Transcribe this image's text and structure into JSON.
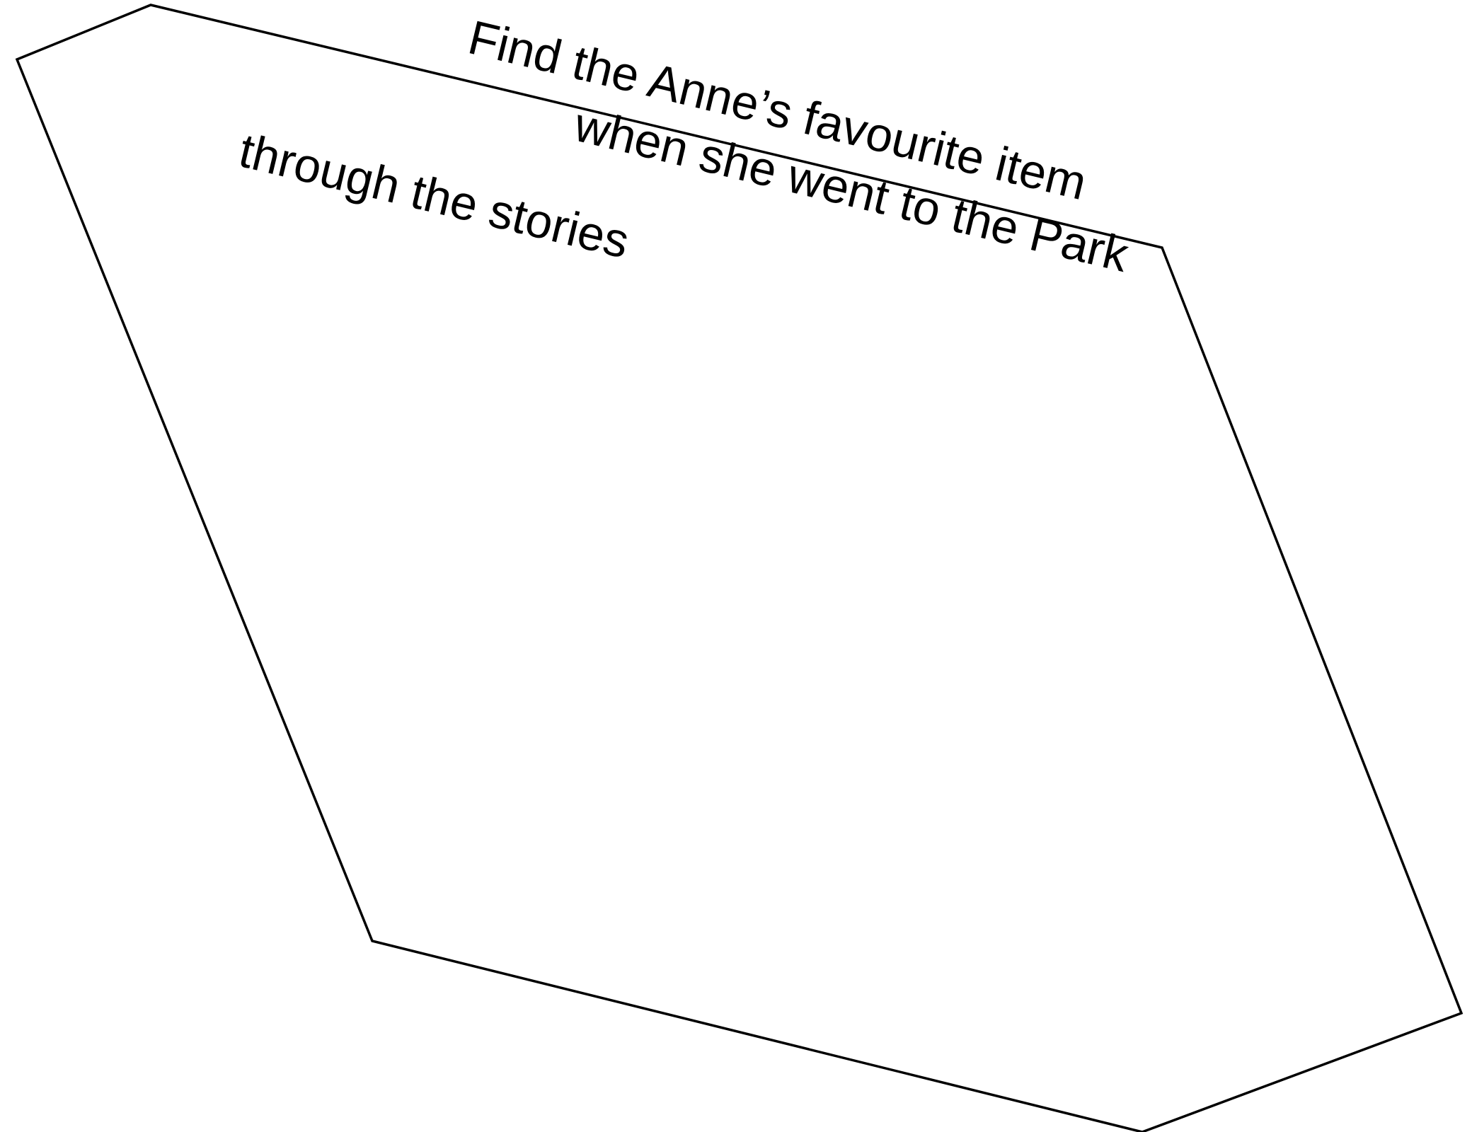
{
  "lines": {
    "line1": "Find the Anne’s favourite item",
    "line2": "when she went to the Park",
    "line3": "through the stories"
  },
  "colors": {
    "outline": "#000000",
    "text": "#000000",
    "background": "#ffffff"
  }
}
